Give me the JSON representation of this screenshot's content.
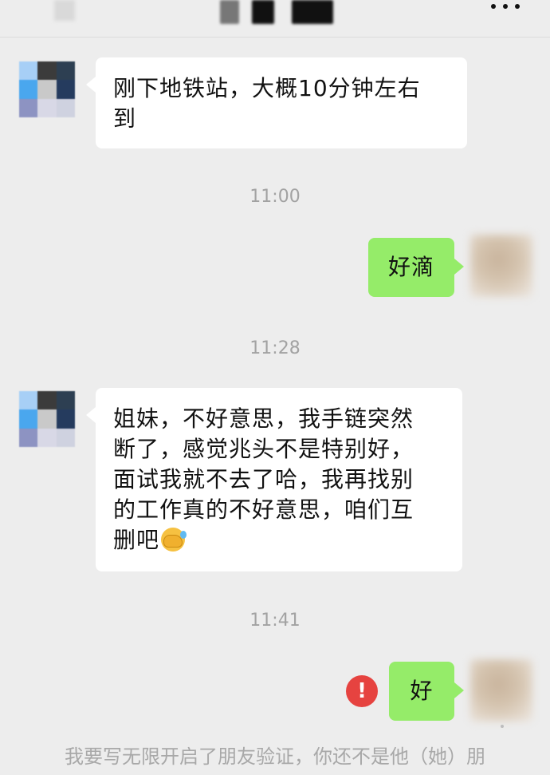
{
  "header": {
    "more_icon": "ellipsis-icon"
  },
  "messages": [
    {
      "side": "left",
      "text_line1": "刚下地铁站，大概10分钟左右",
      "text_line2": "到"
    },
    {
      "side": "right",
      "text": "好滴"
    },
    {
      "side": "left",
      "lines": [
        "姐妹，不好意思，我手链突然",
        "断了，感觉兆头不是特别好，",
        "面试我就不去了哈，我再找别",
        "的工作真的不好意思，咱们互",
        "删吧"
      ],
      "emoji": "face-palm-emoji"
    },
    {
      "side": "right",
      "text": "好",
      "status_icon": "error-icon",
      "status_glyph": "!"
    }
  ],
  "times": [
    "11:00",
    "11:28",
    "11:41"
  ],
  "system_notice": "我要写无限开启了朋友验证，你还不是他（她）朋",
  "colors": {
    "background": "#ededed",
    "bubble_left": "#ffffff",
    "bubble_right": "#95ec69",
    "error": "#e64340",
    "time_text": "#a2a2a2"
  }
}
